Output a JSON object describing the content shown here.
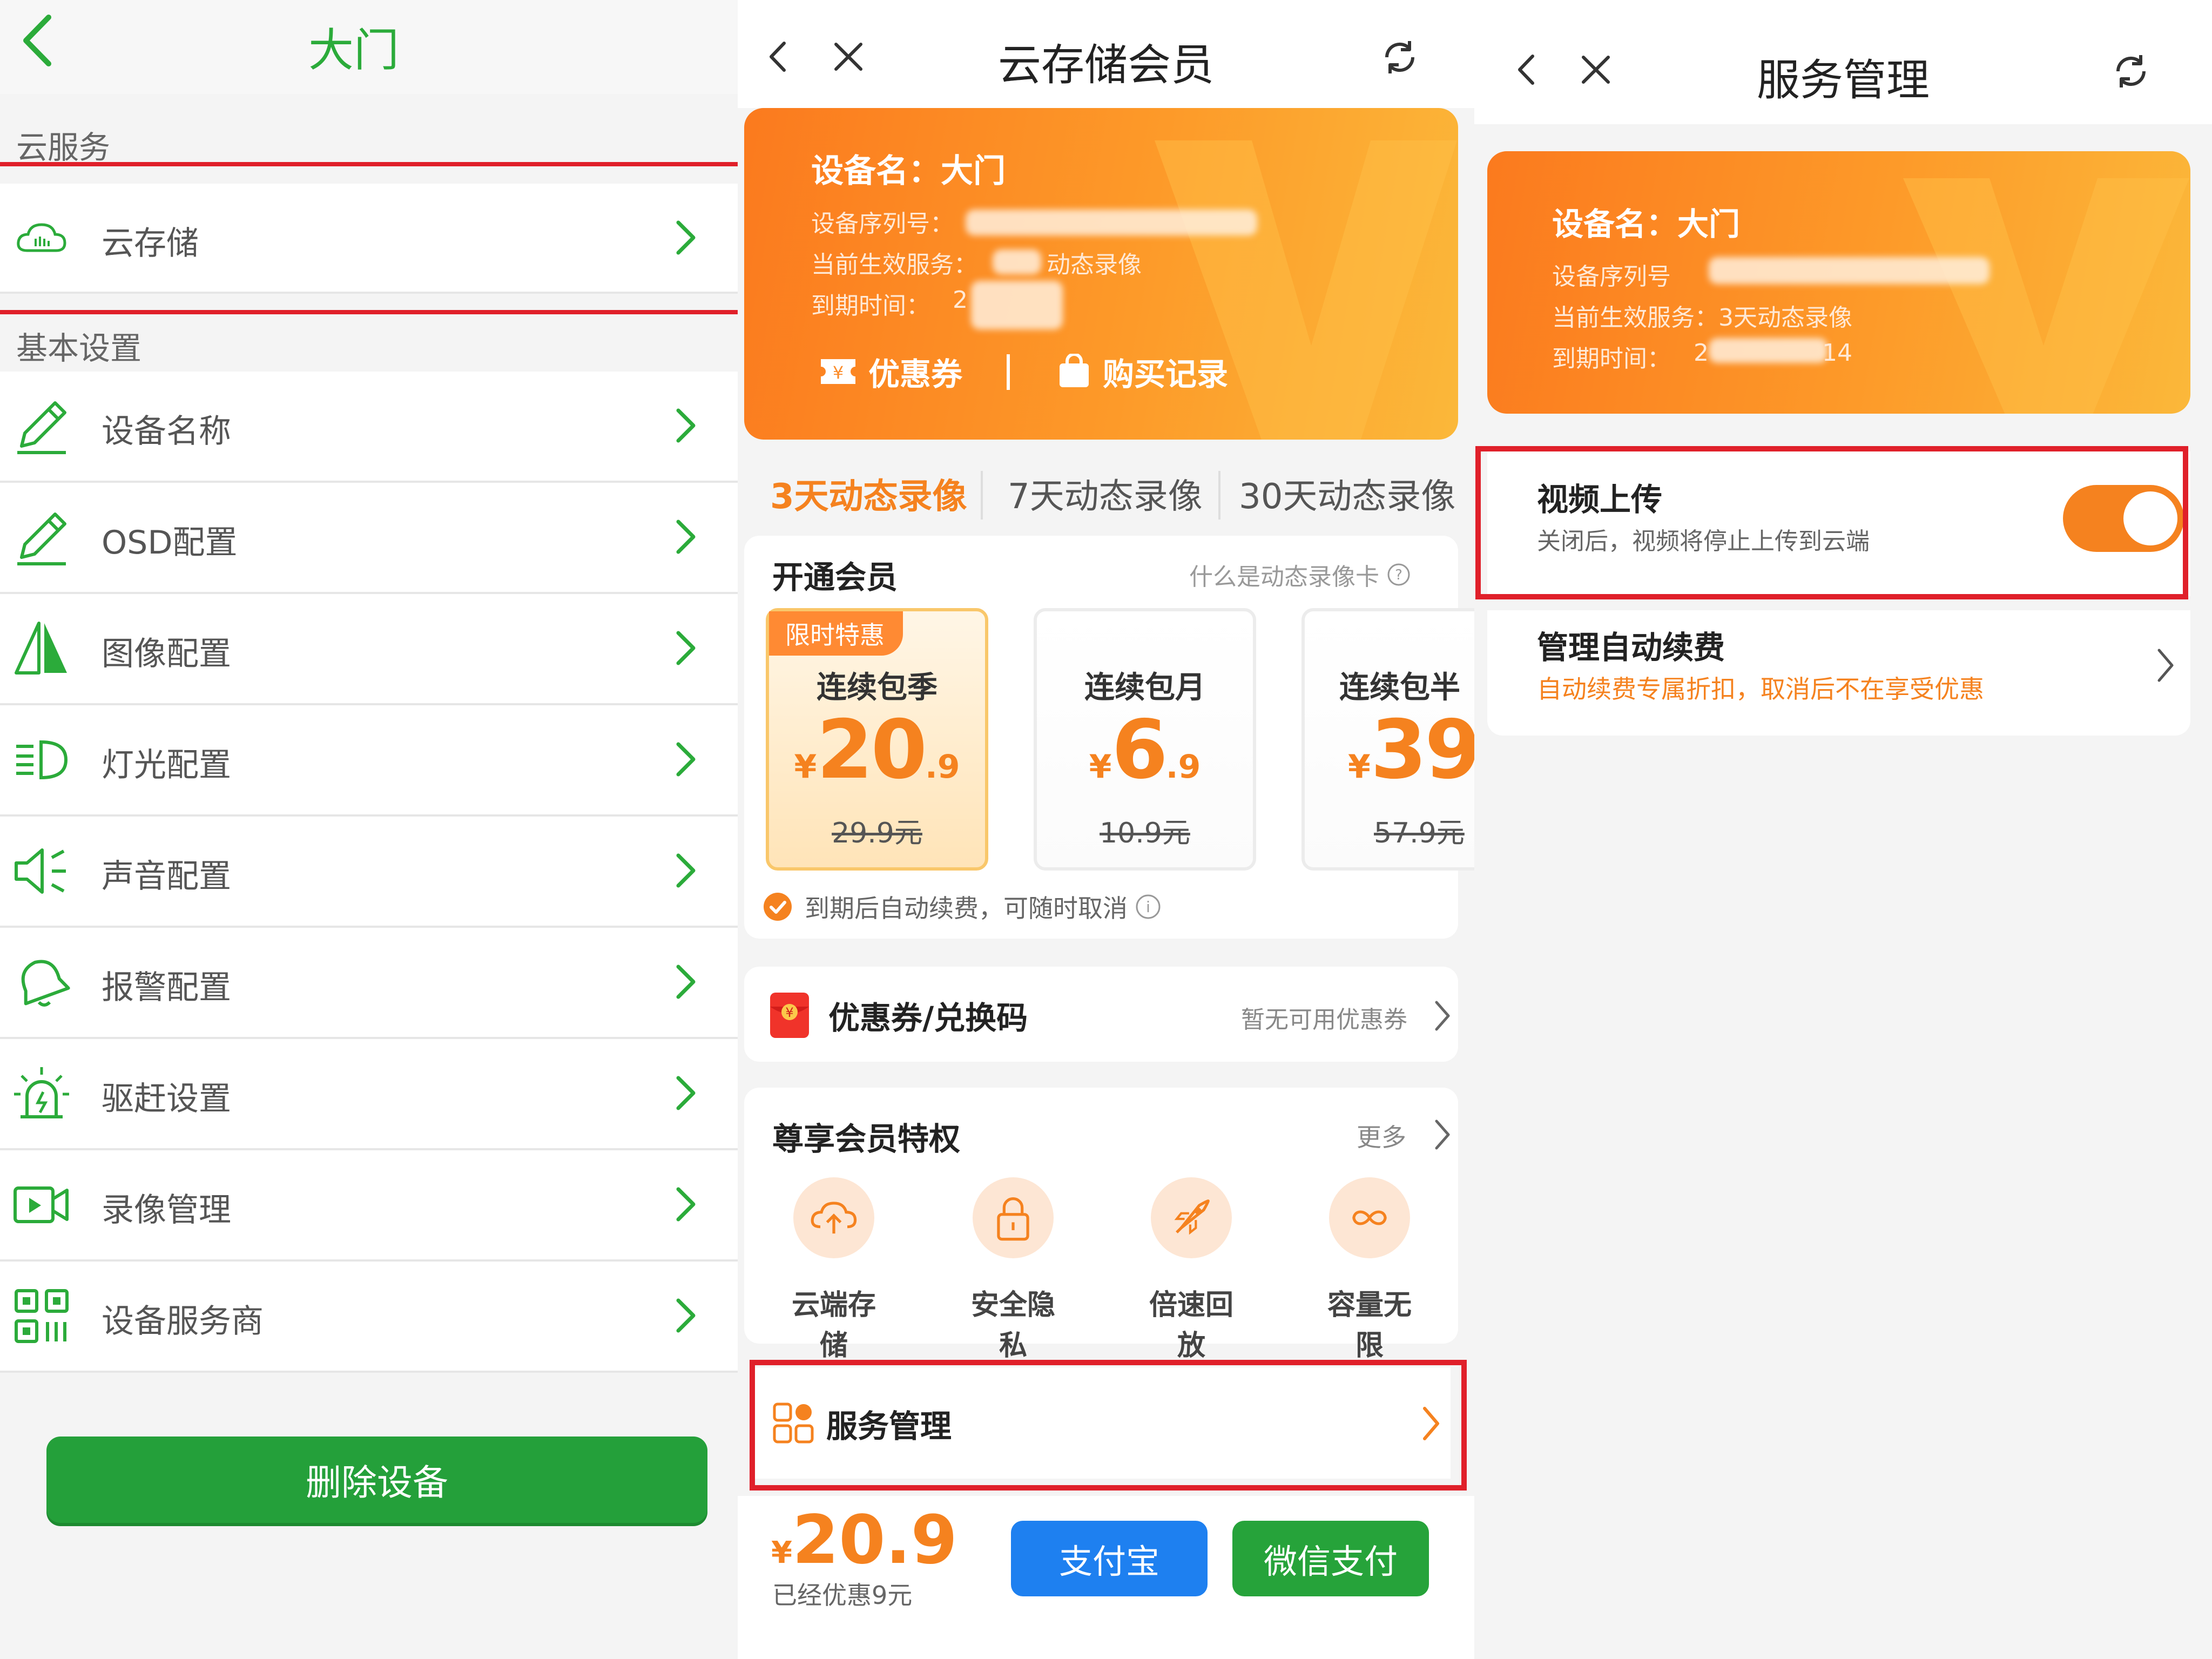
{
  "panel1": {
    "title": "大门",
    "section_cloud": "云服务",
    "cloud_storage": "云存储",
    "section_basic": "基本设置",
    "items": [
      {
        "label": "设备名称",
        "icon": "pencil-icon"
      },
      {
        "label": "OSD配置",
        "icon": "pencil-icon"
      },
      {
        "label": "图像配置",
        "icon": "mirror-triangle-icon"
      },
      {
        "label": "灯光配置",
        "icon": "headlight-icon"
      },
      {
        "label": "声音配置",
        "icon": "speaker-icon"
      },
      {
        "label": "报警配置",
        "icon": "bell-icon"
      },
      {
        "label": "驱赶设置",
        "icon": "alarm-siren-icon"
      },
      {
        "label": "录像管理",
        "icon": "video-camera-icon"
      },
      {
        "label": "设备服务商",
        "icon": "qr-code-icon"
      }
    ],
    "delete_button": "删除设备",
    "accent": "#2bab3a"
  },
  "panel2": {
    "title": "云存储会员",
    "device_name": "设备名：大门",
    "serial_label": "设备序列号：",
    "service_label": "当前生效服务：",
    "service_value": "动态录像",
    "expire_label": "到期时间：",
    "expire_value": "2",
    "coupon_link": "优惠券",
    "purchase_link": "购买记录",
    "tabs": [
      "3天动态录像",
      "7天动态录像",
      "30天动态录像"
    ],
    "active_tab": 0,
    "open_member": "开通会员",
    "what_is": "什么是动态录像卡",
    "packages": [
      {
        "badge": "限时特惠",
        "name": "连续包季",
        "price_int": "20",
        "price_dec": ".9",
        "old": "29.9元",
        "selected": true
      },
      {
        "badge": "",
        "name": "连续包月",
        "price_int": "6",
        "price_dec": ".9",
        "old": "10.9元",
        "selected": false
      },
      {
        "badge": "",
        "name": "连续包半",
        "price_int": "39",
        "price_dec": "",
        "old": "57.9元",
        "selected": false
      }
    ],
    "yen": "¥",
    "auto_renew": "到期后自动续费，可随时取消",
    "coupon_title": "优惠券/兑换码",
    "coupon_status": "暂无可用优惠券",
    "privilege_title": "尊享会员特权",
    "more": "更多",
    "features": [
      {
        "label": "云端存储",
        "icon": "cloud-upload-icon"
      },
      {
        "label": "安全隐私",
        "icon": "lock-icon"
      },
      {
        "label": "倍速回放",
        "icon": "rocket-icon"
      },
      {
        "label": "容量无限",
        "icon": "infinity-icon"
      }
    ],
    "service_mgmt": "服务管理",
    "total_price": "20.9",
    "discount": "已经优惠9元",
    "alipay": "支付宝",
    "wechat": "微信支付",
    "accent": "#f5821f"
  },
  "panel3": {
    "title": "服务管理",
    "device_name": "设备名：大门",
    "serial_label": "设备序列号",
    "service_line": "当前生效服务：3天动态录像",
    "expire_label": "到期时间：",
    "expire_value_a": "2",
    "expire_value_b": "14",
    "video_upload": "视频上传",
    "video_upload_desc": "关闭后，视频将停止上传到云端",
    "auto_renew_title": "管理自动续费",
    "auto_renew_desc": "自动续费专属折扣，取消后不在享受优惠",
    "toggle_on": true
  }
}
